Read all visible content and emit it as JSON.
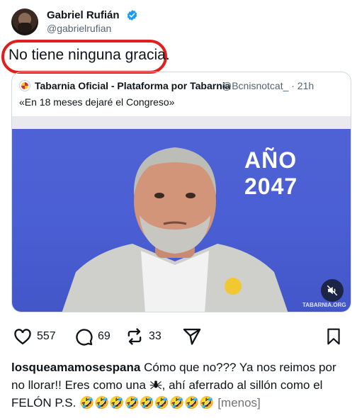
{
  "tweet": {
    "author_name": "Gabriel Rufián",
    "author_handle": "@gabrielrufian",
    "text": "No tiene ninguna gracia."
  },
  "quoted_tweet": {
    "author_name": "Tabarnia Oficial - Plataforma por Tabarnia",
    "handle_time": "@Bcnisnotcat_ · 21h",
    "text": "«En 18 meses dejaré el Congreso»",
    "media_overlay_text": "AÑO 2047",
    "media_watermark": "TABARNIA.ORG"
  },
  "actions": {
    "likes": "557",
    "comments": "69",
    "reposts": "33"
  },
  "caption": {
    "username": "losqueamamosespana",
    "text_before_icon": " Cómo que no??? Ya nos reimos por no llorar!! Eres como una ",
    "text_after_icon": ", ahí aferrado al sillón como el FELÓN P.S. ",
    "emojis": "🤣🤣🤣🤣🤣🤣🤣🤣🤣",
    "more_label": "[menos]"
  },
  "colors": {
    "highlight_circle": "#e01e1e",
    "verified": "#1d9bf0",
    "media_background": "#4a5fd3"
  }
}
